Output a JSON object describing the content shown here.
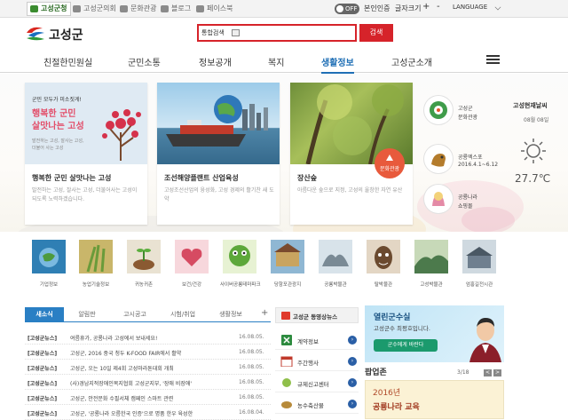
{
  "utility": {
    "tabs": [
      {
        "label": "고성군청",
        "color": "#3b8c2f"
      },
      {
        "label": "고성군의회",
        "color": "#8b8b8b"
      },
      {
        "label": "문화관광",
        "color": "#8b8b8b"
      },
      {
        "label": "블로그",
        "color": "#8b8b8b"
      },
      {
        "label": "페이스북",
        "color": "#8b8b8b"
      }
    ],
    "toggle": "OFF",
    "toggle_label": "본인인증",
    "font_size_label": "글자크기",
    "plus": "+",
    "minus": "-",
    "language": "LANGUAGE"
  },
  "header": {
    "logo_text": "고성군",
    "search_scope": "통합검색",
    "search_button": "검색"
  },
  "gnb": [
    {
      "label": "친절한민원실"
    },
    {
      "label": "군민소통"
    },
    {
      "label": "정보공개"
    },
    {
      "label": "복지"
    },
    {
      "label": "생활정보"
    },
    {
      "label": "고성군소개"
    }
  ],
  "hero": {
    "cards": [
      {
        "img_line1": "군민 모두가 미소짓게!",
        "img_line2": "행복한 군민",
        "img_line3": "살맛나는 고성",
        "img_small1": "발전하는 고성, 잘사는 고성,",
        "img_small2": "더불어 사는 고성",
        "title": "행복한 군민 살맛나는 고성",
        "desc": "발전하는 고성, 잘사는 고성, 더불어사는 고성이 되도록 노력하겠습니다."
      },
      {
        "title": "조선해양플랜트 산업육성",
        "desc": "고성조선산업의 융성화, 고성 경제의 활기찬 새 도약"
      },
      {
        "title": "장산숲",
        "desc": "아름다운 숲으로 지정, 고성의 울창한 자연 유산",
        "badge": "문화관광"
      }
    ],
    "quick": [
      {
        "line1": "고성군",
        "line2": "문화관광"
      },
      {
        "line1": "공룡엑스포",
        "line2": "2016.4.1~6.12"
      },
      {
        "line1": "공룡나라",
        "line2": "쇼핑몰"
      }
    ],
    "weather": {
      "title": "고성현재날씨",
      "date": "08월 08일",
      "temp": "27.7℃"
    }
  },
  "icons": [
    {
      "label": "기업정보",
      "color": "#2f7fb4"
    },
    {
      "label": "농업기술정보",
      "color": "#6a9b3a"
    },
    {
      "label": "귀농귀촌",
      "color": "#9a7b4f"
    },
    {
      "label": "보건/건강",
      "color": "#d64b62"
    },
    {
      "label": "사이버공룡테마파크",
      "color": "#5da83a"
    },
    {
      "label": "당항포관광지",
      "color": "#5f8fb0"
    },
    {
      "label": "공룡박물관",
      "color": "#7a8a95"
    },
    {
      "label": "탈박물관",
      "color": "#6b4a2f"
    },
    {
      "label": "고성박물관",
      "color": "#4c7a4c"
    },
    {
      "label": "엄홍길전시관",
      "color": "#6f7f8f"
    }
  ],
  "news": {
    "tabs": [
      "새소식",
      "알림판",
      "고시공고",
      "시험/취업",
      "생활정보"
    ],
    "plus": "+",
    "items": [
      {
        "cat": "[고성군뉴스]",
        "title": "여름휴가, 공룡나라 고성에서 보내세요!",
        "date": "16.08.05."
      },
      {
        "cat": "[고성군뉴스]",
        "title": "고성군, 2016 중국 청두 K-FOOD FAIR에서 활약",
        "date": "16.08.05."
      },
      {
        "cat": "[고성군뉴스]",
        "title": "고성군, 오는 10일 제4회 고성마라톤대회 개최",
        "date": "16.08.05."
      },
      {
        "cat": "[고성군뉴스]",
        "title": "(사)경남지적장애인복지협회 고성군지부, '장애 비장애'",
        "date": "16.08.05."
      },
      {
        "cat": "[고성군뉴스]",
        "title": "고성군, 안전문화 수필서체 캠페인 스마트 관련",
        "date": "16.08.05."
      },
      {
        "cat": "[고성군뉴스]",
        "title": "고성군, '공룡나라 오름한국 인증'으로 명품 한우 육성한",
        "date": "16.08.04."
      }
    ]
  },
  "video": {
    "title": "고성군 동영상뉴스"
  },
  "services": [
    {
      "label": "계약정보",
      "arrow": "›"
    },
    {
      "label": "주간행사",
      "arrow": "›"
    },
    {
      "label": "규제신고센터",
      "arrow": "›"
    },
    {
      "label": "농수축산물",
      "arrow": "›"
    }
  ],
  "mayor": {
    "title": "열린군수실",
    "sub": "고성군수 최평호입니다.",
    "button": "군수에게 바란다"
  },
  "popup": {
    "title": "팝업존",
    "counter": "3/18",
    "prev": "<",
    "next": ">",
    "img_year": "2016년",
    "img_main": "공룡나라 교육"
  }
}
